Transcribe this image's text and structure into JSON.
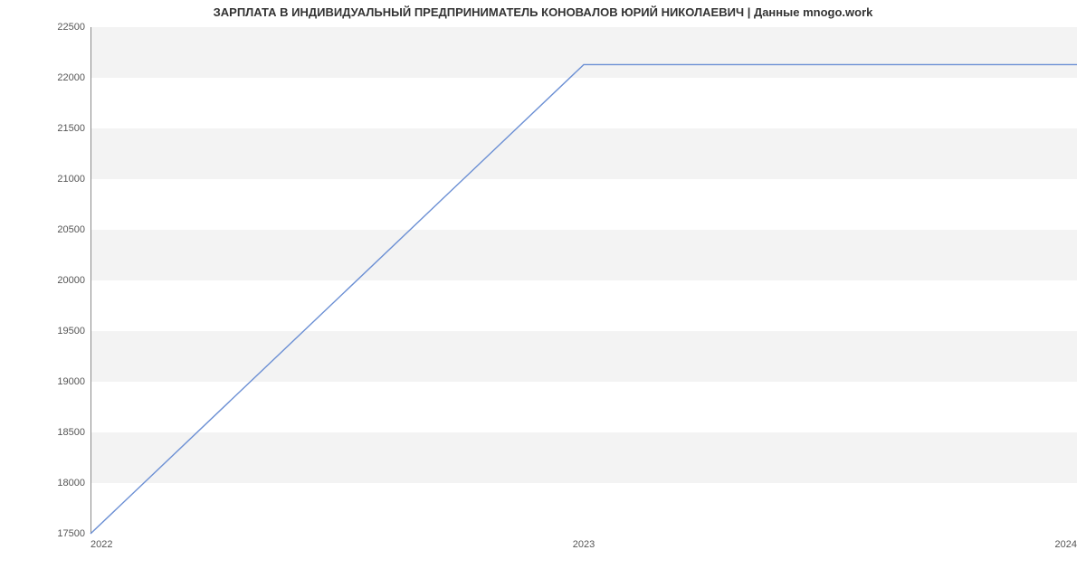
{
  "chart_data": {
    "type": "line",
    "title": "ЗАРПЛАТА В ИНДИВИДУАЛЬНЫЙ ПРЕДПРИНИМАТЕЛЬ КОНОВАЛОВ ЮРИЙ НИКОЛАЕВИЧ | Данные mnogo.work",
    "x": [
      2022,
      2023,
      2024
    ],
    "values": [
      17500,
      22130,
      22130
    ],
    "x_ticks": [
      "2022",
      "2023",
      "2024"
    ],
    "y_ticks": [
      17500,
      18000,
      18500,
      19000,
      19500,
      20000,
      20500,
      21000,
      21500,
      22000,
      22500
    ],
    "xlim": [
      2022,
      2024
    ],
    "ylim": [
      17500,
      22500
    ],
    "xlabel": "",
    "ylabel": "",
    "series_color": "#6b8fd4",
    "grid": true
  }
}
